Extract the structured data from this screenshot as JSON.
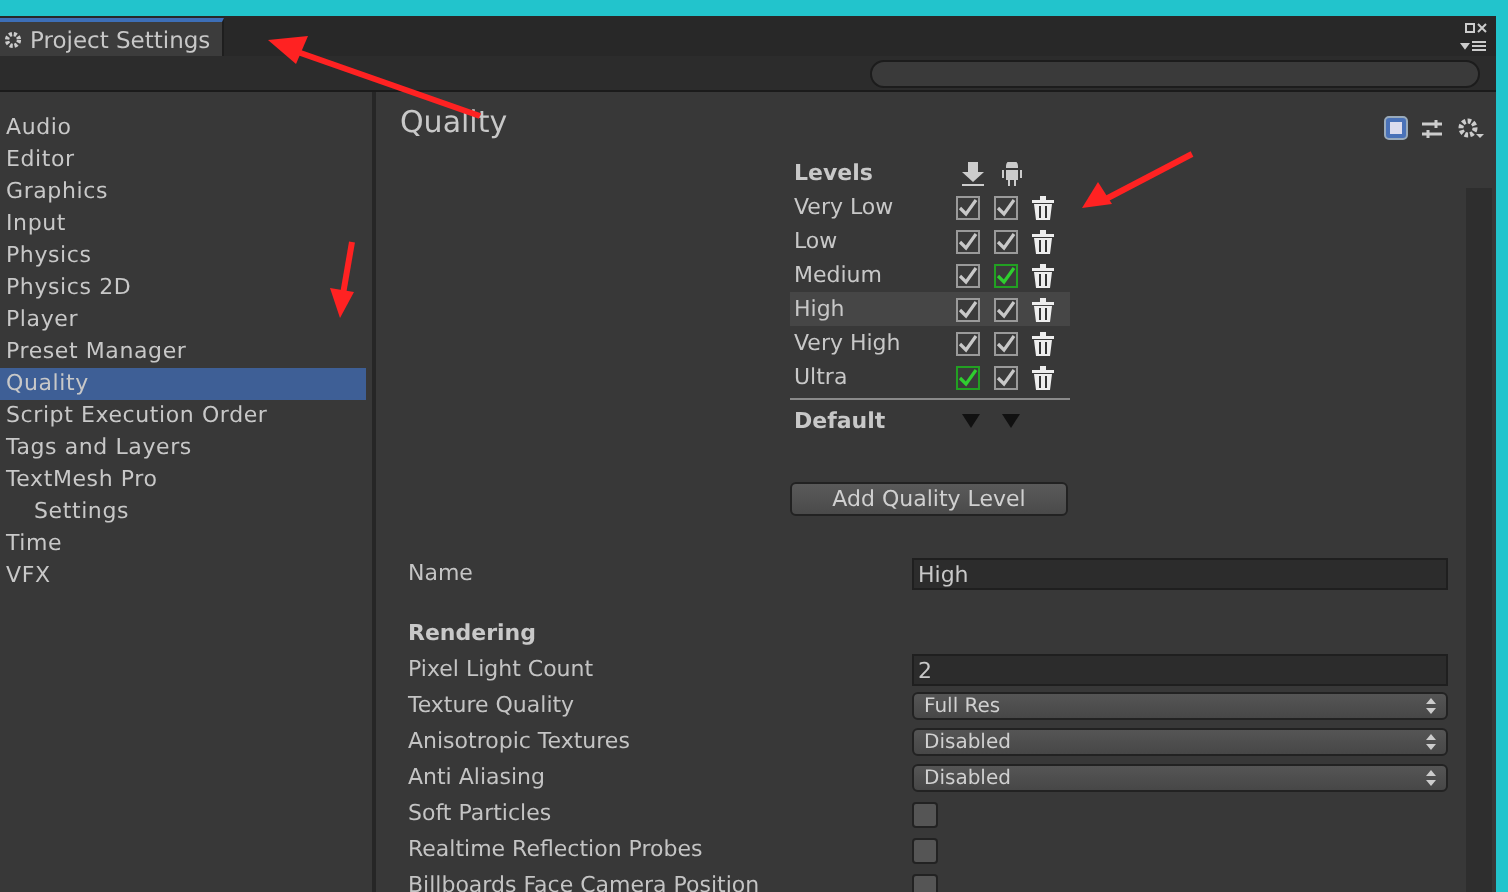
{
  "window": {
    "tab": {
      "label": "Project Settings",
      "selected": true
    }
  },
  "sidebar": {
    "items": [
      {
        "label": "Audio",
        "selected": false
      },
      {
        "label": "Editor",
        "selected": false
      },
      {
        "label": "Graphics",
        "selected": false
      },
      {
        "label": "Input",
        "selected": false
      },
      {
        "label": "Physics",
        "selected": false
      },
      {
        "label": "Physics 2D",
        "selected": false
      },
      {
        "label": "Player",
        "selected": false
      },
      {
        "label": "Preset Manager",
        "selected": false
      },
      {
        "label": "Quality",
        "selected": true
      },
      {
        "label": "Script Execution Order",
        "selected": false
      },
      {
        "label": "Tags and Layers",
        "selected": false
      },
      {
        "label": "TextMesh Pro",
        "selected": false,
        "children": [
          {
            "label": "Settings",
            "selected": false
          }
        ]
      },
      {
        "label": "Time",
        "selected": false
      },
      {
        "label": "VFX",
        "selected": false
      }
    ]
  },
  "content": {
    "title": "Quality",
    "levels": {
      "title": "Levels",
      "default_label": "Default",
      "add_button": "Add Quality Level",
      "rows": [
        {
          "name": "Very Low",
          "selected": false,
          "standalone": true,
          "android": true,
          "standalone_default": false,
          "android_default": false
        },
        {
          "name": "Low",
          "selected": false,
          "standalone": true,
          "android": true,
          "standalone_default": false,
          "android_default": false
        },
        {
          "name": "Medium",
          "selected": false,
          "standalone": true,
          "android": true,
          "standalone_default": false,
          "android_default": true
        },
        {
          "name": "High",
          "selected": true,
          "standalone": true,
          "android": true,
          "standalone_default": false,
          "android_default": false
        },
        {
          "name": "Very High",
          "selected": false,
          "standalone": true,
          "android": true,
          "standalone_default": false,
          "android_default": false
        },
        {
          "name": "Ultra",
          "selected": false,
          "standalone": true,
          "android": true,
          "standalone_default": true,
          "android_default": false
        }
      ]
    },
    "settings": [
      {
        "kind": "field",
        "label": "Name",
        "value": "High"
      },
      {
        "kind": "heading",
        "label": "Rendering"
      },
      {
        "kind": "field",
        "label": "Pixel Light Count",
        "value": "2"
      },
      {
        "kind": "dropdown",
        "label": "Texture Quality",
        "value": "Full Res"
      },
      {
        "kind": "dropdown",
        "label": "Anisotropic Textures",
        "value": "Disabled"
      },
      {
        "kind": "dropdown",
        "label": "Anti Aliasing",
        "value": "Disabled"
      },
      {
        "kind": "checkbox",
        "label": "Soft Particles",
        "checked": false
      },
      {
        "kind": "checkbox",
        "label": "Realtime Reflection Probes",
        "checked": false
      },
      {
        "kind": "checkbox",
        "label": "Billboards Face Camera Position",
        "checked": false
      }
    ]
  }
}
